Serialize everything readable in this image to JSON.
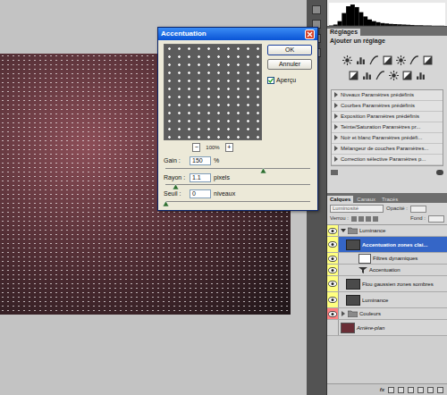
{
  "histogram": {
    "values": [
      2,
      6,
      22,
      60,
      92,
      100,
      88,
      64,
      44,
      30,
      22,
      17,
      13,
      11,
      9,
      8,
      7,
      6,
      5,
      4,
      3,
      3,
      2,
      2,
      1,
      1,
      1
    ]
  },
  "dialog": {
    "title": "Accentuation",
    "buttons": [
      "OK",
      "Annuler"
    ],
    "preview_checkbox": {
      "label": "Aperçu",
      "checked": true
    },
    "zoom": {
      "minus": "−",
      "value": "100%",
      "plus": "+"
    },
    "fields": [
      {
        "label": "Gain :",
        "value": "150",
        "unit": "%",
        "level": 0.67
      },
      {
        "label": "Rayon :",
        "value": "1.1",
        "unit": "pixels",
        "level": 0.07
      },
      {
        "label": "Seuil :",
        "value": "0",
        "unit": "niveaux",
        "level": 0
      }
    ]
  },
  "adjustments": {
    "tab": "Réglages",
    "heading": "Ajouter un réglage",
    "presets": [
      "Niveaux Paramètres prédéfinis",
      "Courbes Paramètres prédéfinis",
      "Exposition Paramètres prédéfinis",
      "Teinte/Saturation Paramètres pr...",
      "Noir et blanc Paramètres prédéfi...",
      "Mélangeur de couches Paramètres...",
      "Correction sélective Paramètres p..."
    ]
  },
  "layers_panel": {
    "tabs": [
      {
        "label": "Calques",
        "selected": true
      },
      {
        "label": "Canaux",
        "selected": false
      },
      {
        "label": "Tracés",
        "selected": false
      }
    ],
    "blend_mode": "Luminosité",
    "opacity_label": "Opacité :",
    "lock_label": "Verrou :",
    "fill_label": "Fond :",
    "layers": [
      {
        "name": "Luminance",
        "kind": "group",
        "depth": 0,
        "visible": true,
        "expanded": true,
        "selected": false,
        "italic": false,
        "color": "#ffff80"
      },
      {
        "name": "Accentuation zones clai...",
        "kind": "layer",
        "depth": 1,
        "visible": true,
        "expanded": false,
        "selected": true,
        "italic": false,
        "color": "#ffff80"
      },
      {
        "name": "Filtres dynamiques",
        "kind": "mask",
        "depth": 2,
        "visible": true,
        "expanded": false,
        "selected": false,
        "italic": false,
        "color": "#ffff80"
      },
      {
        "name": "Accentuation",
        "kind": "filter",
        "depth": 2,
        "visible": true,
        "expanded": false,
        "selected": false,
        "italic": false,
        "color": "#ffff80"
      },
      {
        "name": "Flou gaussien zones sombres",
        "kind": "layer",
        "depth": 1,
        "visible": true,
        "expanded": false,
        "selected": false,
        "italic": false,
        "color": "#ffff80"
      },
      {
        "name": "Luminance",
        "kind": "layer",
        "depth": 1,
        "visible": true,
        "expanded": false,
        "selected": false,
        "italic": false,
        "color": "#ffff80"
      },
      {
        "name": "Couleurs",
        "kind": "group",
        "depth": 0,
        "visible": true,
        "expanded": false,
        "selected": false,
        "italic": false,
        "color": "#ff8080"
      },
      {
        "name": "Arrière-plan",
        "kind": "background",
        "depth": 0,
        "visible": false,
        "expanded": false,
        "selected": false,
        "italic": true,
        "color": "#d4d4d4"
      }
    ],
    "footer": {
      "fx": "fx"
    }
  }
}
